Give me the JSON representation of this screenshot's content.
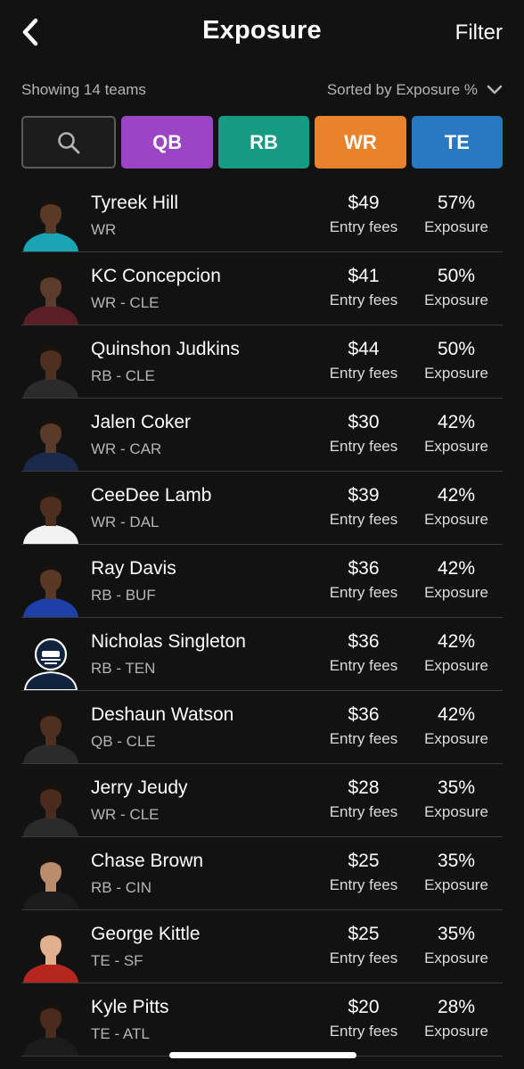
{
  "header": {
    "back_icon": "chevron-left-icon",
    "title": "Exposure",
    "filter_label": "Filter"
  },
  "subbar": {
    "showing_text": "Showing 14 teams",
    "sorted_text": "Sorted by Exposure %",
    "sort_icon": "chevron-down-icon"
  },
  "chips": [
    {
      "label": "",
      "icon": "search-icon",
      "color": "#1c1c1c"
    },
    {
      "label": "QB",
      "color": "#9b45c4"
    },
    {
      "label": "RB",
      "color": "#159b82"
    },
    {
      "label": "WR",
      "color": "#e8822b"
    },
    {
      "label": "TE",
      "color": "#2878c2"
    }
  ],
  "players": [
    {
      "name": "Tyreek Hill",
      "position": "WR",
      "fee": "$49",
      "fee_label": "Entry fees",
      "exposure": "57%",
      "exposure_label": "Exposure",
      "jersey_color": "#1aa5b5",
      "skin": "#5a3a26"
    },
    {
      "name": "KC Concepcion",
      "position": "WR - CLE",
      "fee": "$41",
      "fee_label": "Entry fees",
      "exposure": "50%",
      "exposure_label": "Exposure",
      "jersey_color": "#5a1e26",
      "skin": "#5b3b2a"
    },
    {
      "name": "Quinshon Judkins",
      "position": "RB - CLE",
      "fee": "$44",
      "fee_label": "Entry fees",
      "exposure": "50%",
      "exposure_label": "Exposure",
      "jersey_color": "#2b2b2b",
      "skin": "#4e3020"
    },
    {
      "name": "Jalen Coker",
      "position": "WR - CAR",
      "fee": "$30",
      "fee_label": "Entry fees",
      "exposure": "42%",
      "exposure_label": "Exposure",
      "jersey_color": "#1a2a4a",
      "skin": "#5a3a28"
    },
    {
      "name": "CeeDee Lamb",
      "position": "WR - DAL",
      "fee": "$39",
      "fee_label": "Entry fees",
      "exposure": "42%",
      "exposure_label": "Exposure",
      "jersey_color": "#f2f2f2",
      "skin": "#4d2f20"
    },
    {
      "name": "Ray Davis",
      "position": "RB - BUF",
      "fee": "$36",
      "fee_label": "Entry fees",
      "exposure": "42%",
      "exposure_label": "Exposure",
      "jersey_color": "#1c3fa8",
      "skin": "#5a3826"
    },
    {
      "name": "Nicholas Singleton",
      "position": "RB - TEN",
      "fee": "$36",
      "fee_label": "Entry fees",
      "exposure": "42%",
      "exposure_label": "Exposure",
      "jersey_color": "#10233f",
      "skin": ""
    },
    {
      "name": "Deshaun Watson",
      "position": "QB - CLE",
      "fee": "$36",
      "fee_label": "Entry fees",
      "exposure": "42%",
      "exposure_label": "Exposure",
      "jersey_color": "#2b2b2b",
      "skin": "#4e3020"
    },
    {
      "name": "Jerry Jeudy",
      "position": "WR - CLE",
      "fee": "$28",
      "fee_label": "Entry fees",
      "exposure": "35%",
      "exposure_label": "Exposure",
      "jersey_color": "#2b2b2b",
      "skin": "#4a2c1e"
    },
    {
      "name": "Chase Brown",
      "position": "RB - CIN",
      "fee": "$25",
      "fee_label": "Entry fees",
      "exposure": "35%",
      "exposure_label": "Exposure",
      "jersey_color": "#1b1b1b",
      "skin": "#b98d6b"
    },
    {
      "name": "George Kittle",
      "position": "TE - SF",
      "fee": "$25",
      "fee_label": "Entry fees",
      "exposure": "35%",
      "exposure_label": "Exposure",
      "jersey_color": "#b5271e",
      "skin": "#e0b08f"
    },
    {
      "name": "Kyle Pitts",
      "position": "TE - ATL",
      "fee": "$20",
      "fee_label": "Entry fees",
      "exposure": "28%",
      "exposure_label": "Exposure",
      "jersey_color": "#1b1b1b",
      "skin": "#4a2c1e"
    }
  ]
}
